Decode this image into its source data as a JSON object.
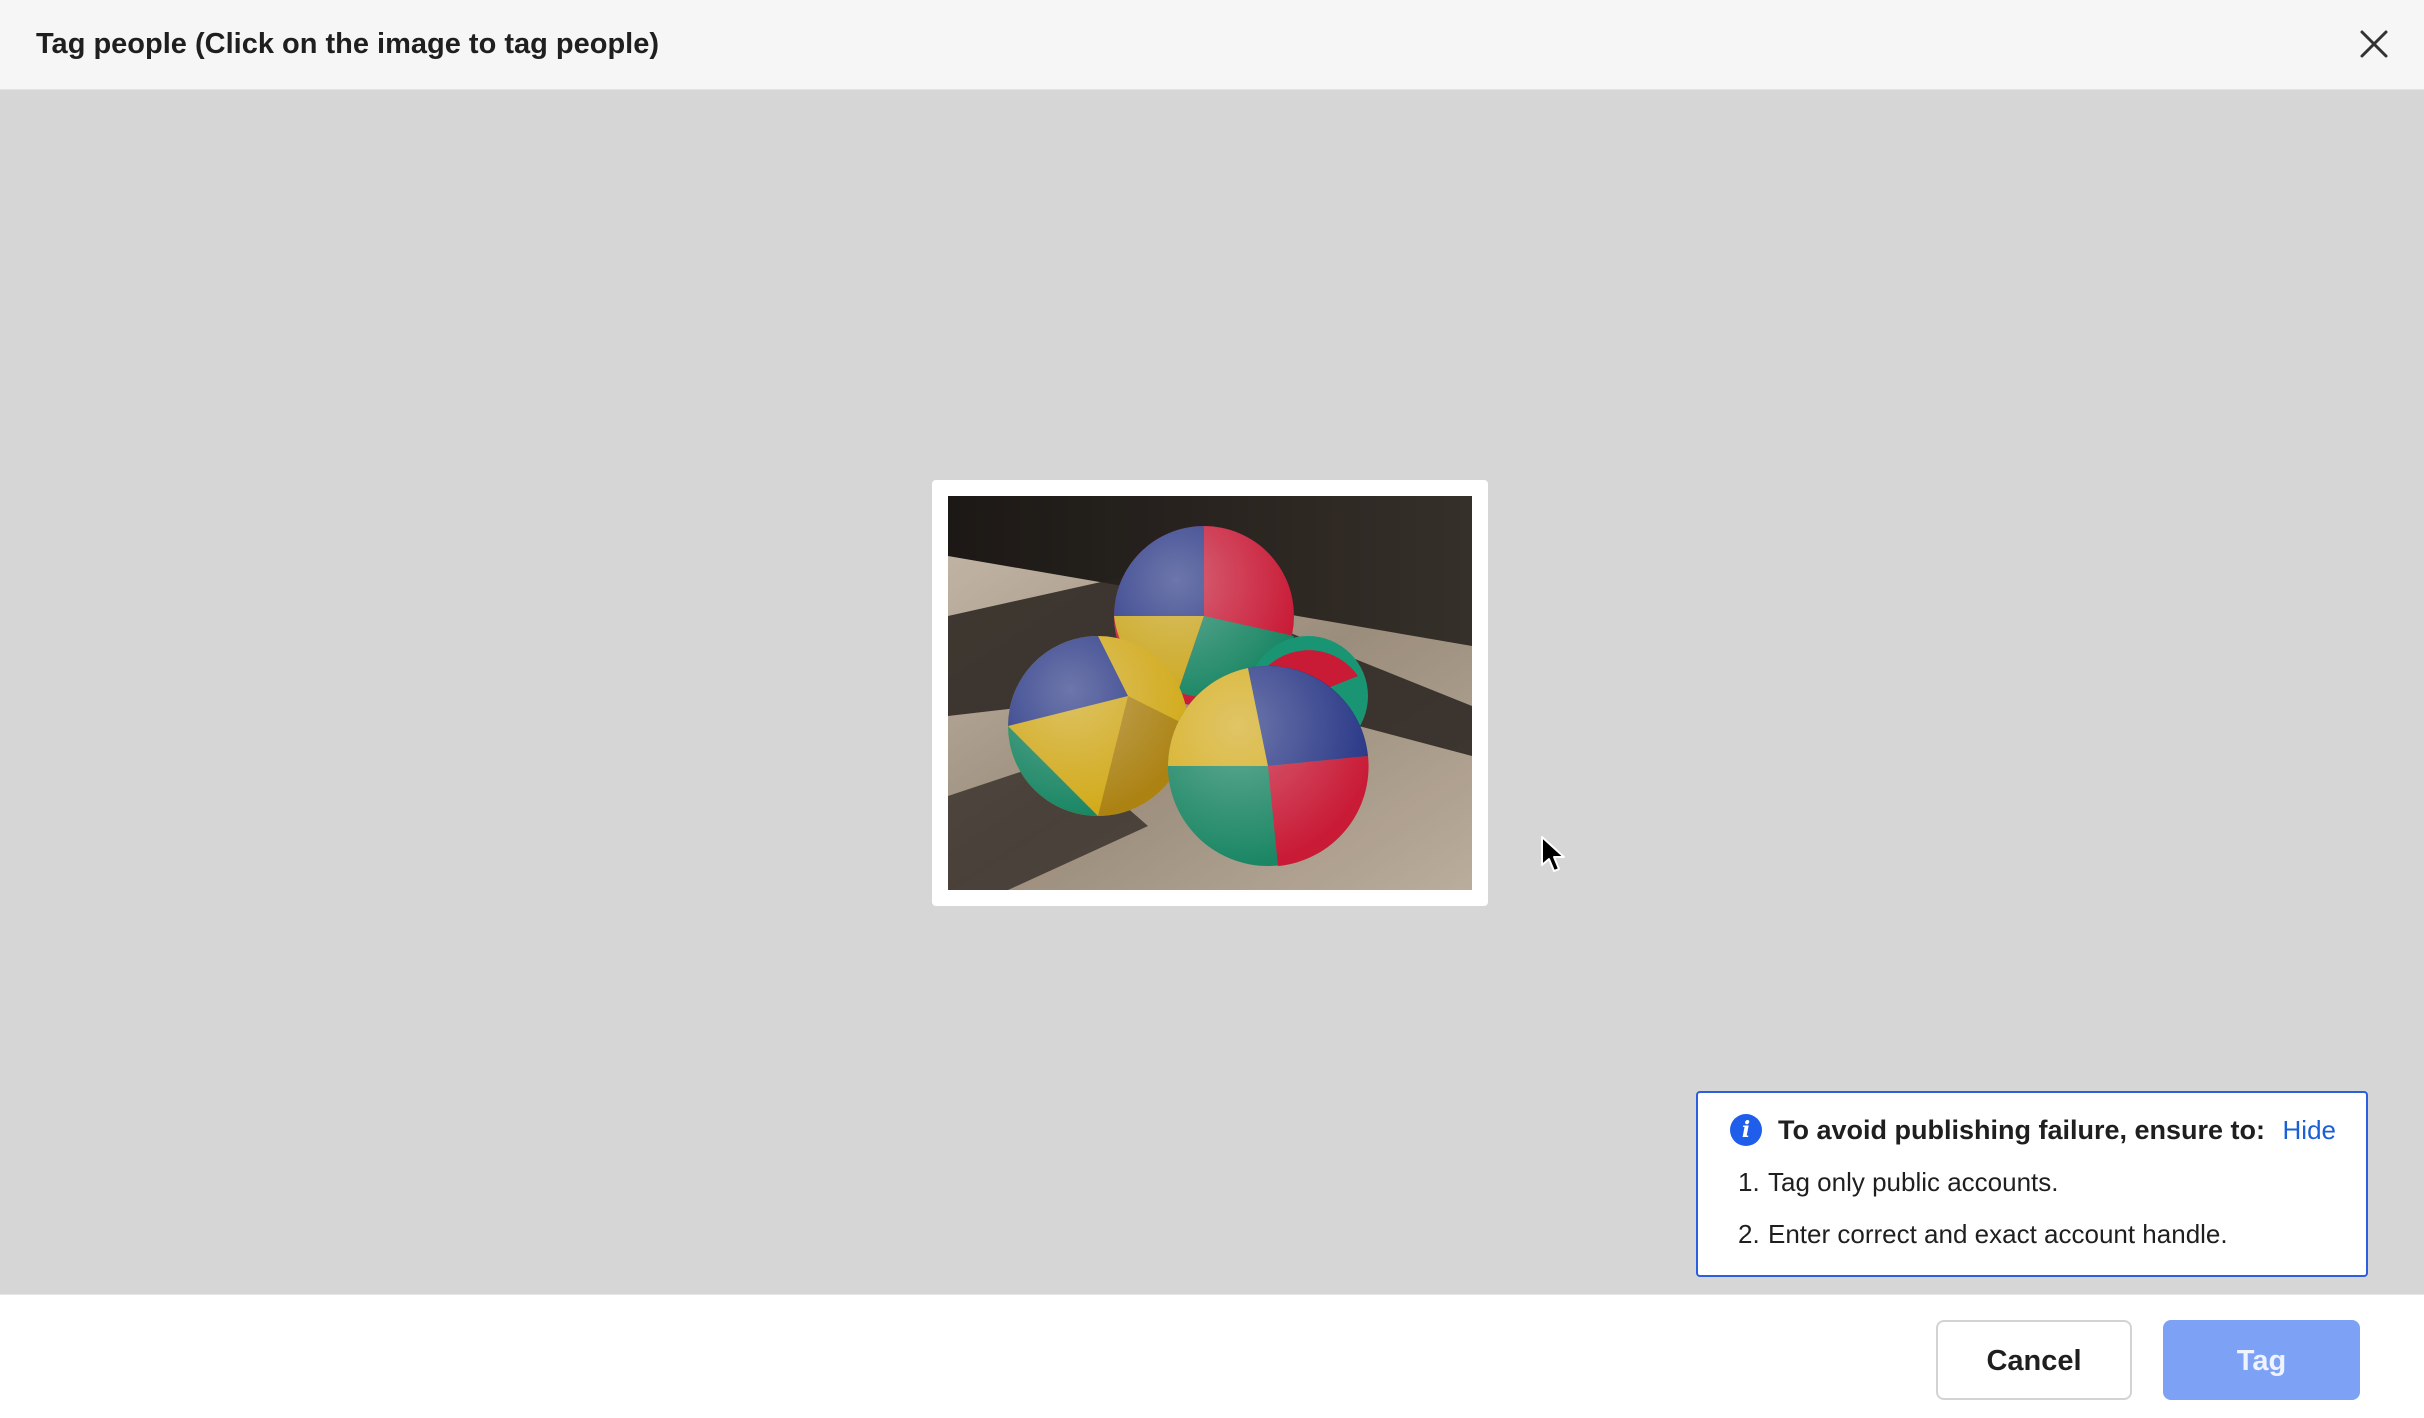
{
  "header": {
    "title": "Tag people (Click on the image to tag people)",
    "close_icon": "close-icon"
  },
  "canvas": {
    "image_alt": "juggling-balls-photo",
    "cursor_icon": "arrow-cursor-icon"
  },
  "notice": {
    "icon": "info-icon",
    "icon_glyph": "i",
    "heading": "To avoid publishing failure, ensure to:",
    "hide_label": "Hide",
    "items": [
      {
        "num": "1.",
        "text": "Tag only public accounts."
      },
      {
        "num": "2.",
        "text": "Enter correct and exact account handle."
      }
    ]
  },
  "footer": {
    "cancel_label": "Cancel",
    "tag_label": "Tag"
  },
  "colors": {
    "accent": "#2b5fe0",
    "tag_button": "#7da1f5",
    "canvas_bg": "#d6d6d6",
    "link": "#1a5fd6"
  }
}
